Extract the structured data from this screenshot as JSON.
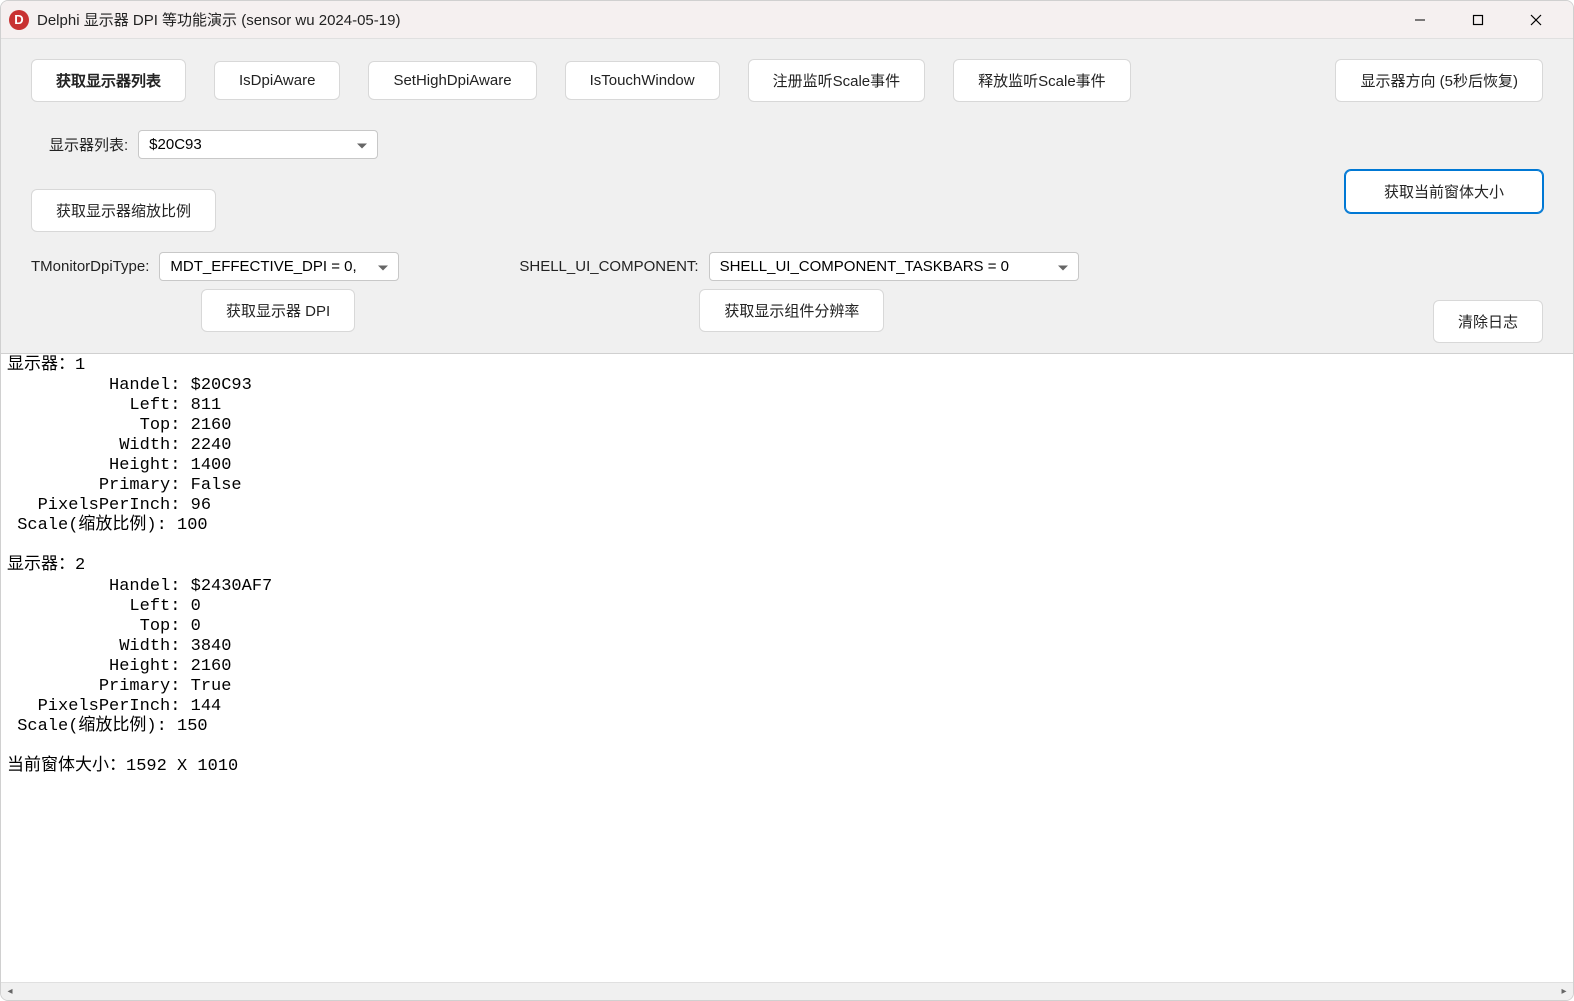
{
  "titlebar": {
    "icon_letter": "D",
    "title": "Delphi  显示器 DPI 等功能演示     (sensor wu   2024-05-19)"
  },
  "toolbar": {
    "get_monitor_list": "获取显示器列表",
    "is_dpi_aware": "IsDpiAware",
    "set_high_dpi_aware": "SetHighDpiAware",
    "is_touch_window": "IsTouchWindow",
    "register_scale_event": "注册监听Scale事件",
    "release_scale_event": "释放监听Scale事件",
    "monitor_direction": "显示器方向  (5秒后恢复)"
  },
  "monitor_list": {
    "label": "显示器列表:",
    "value": "$20C93"
  },
  "buttons": {
    "get_scale": "获取显示器缩放比例",
    "get_window_size": "获取当前窗体大小",
    "get_monitor_dpi": "获取显示器 DPI",
    "get_component_res": "获取显示组件分辨率",
    "clear_log": "清除日志"
  },
  "dpi_type": {
    "label": "TMonitorDpiType:",
    "value": "MDT_EFFECTIVE_DPI = 0,"
  },
  "shell_component": {
    "label": "SHELL_UI_COMPONENT:",
    "value": "SHELL_UI_COMPONENT_TASKBARS  = 0"
  },
  "log": "显示器：1\n          Handel: $20C93\n            Left: 811\n             Top: 2160\n           Width: 2240\n          Height: 1400\n         Primary: False\n   PixelsPerInch: 96\n Scale(缩放比例): 100\n\n显示器：2\n          Handel: $2430AF7\n            Left: 0\n             Top: 0\n           Width: 3840\n          Height: 2160\n         Primary: True\n   PixelsPerInch: 144\n Scale(缩放比例): 150\n\n当前窗体大小：1592 X 1010"
}
